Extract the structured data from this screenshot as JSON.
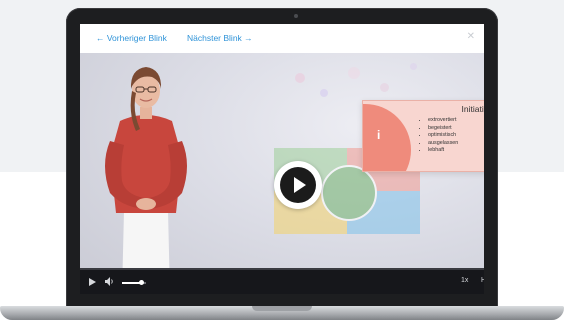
{
  "nav": {
    "prev_label": "← Vorheriger Blink",
    "next_label": "Nächster Blink →",
    "close_icon": "close-icon"
  },
  "slide": {
    "card": {
      "letter": "i",
      "title": "Initiativ",
      "items": [
        "extrovertiert",
        "begeistert",
        "optimistisch",
        "ausgelassen",
        "lebhaft"
      ],
      "color": "#f8d6d0"
    }
  },
  "player": {
    "state": "paused",
    "progress_percent": 0,
    "volume_percent": 80,
    "speed_label": "1x",
    "quality_label": "HD",
    "accent_color": "#2f93d8"
  },
  "colors": {
    "link_blue": "#2f93d8",
    "controls_bg": "#16171b"
  }
}
